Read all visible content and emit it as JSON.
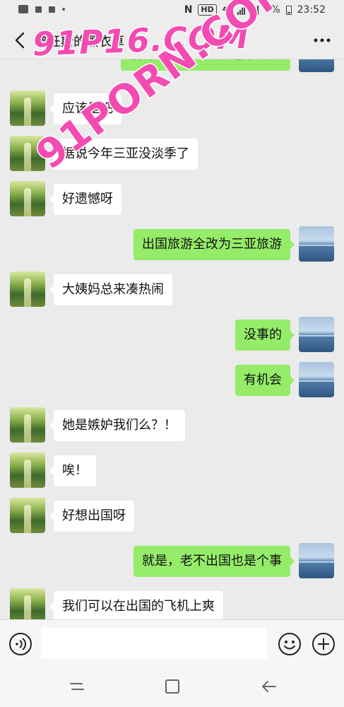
{
  "status_bar": {
    "network": "4G",
    "hd": "HD",
    "battery_percent": "5%",
    "time": "23:52"
  },
  "header": {
    "title": "普旺斯的薰衣草"
  },
  "messages": [
    {
      "side": "right",
      "text": "估计三亚这几天人也不会少"
    },
    {
      "side": "left",
      "text": "应该是吧"
    },
    {
      "side": "left",
      "text": "据说今年三亚没淡季了"
    },
    {
      "side": "left",
      "text": "好遗憾呀"
    },
    {
      "side": "right",
      "text": "出国旅游全改为三亚旅游"
    },
    {
      "side": "left",
      "text": "大姨妈总来凑热闹"
    },
    {
      "side": "right",
      "text": "没事的"
    },
    {
      "side": "right",
      "text": "有机会"
    },
    {
      "side": "left",
      "text": "她是嫉妒我们么？！"
    },
    {
      "side": "left",
      "text": "唉！"
    },
    {
      "side": "left",
      "text": "好想出国呀"
    },
    {
      "side": "right",
      "text": "就是，老不出国也是个事"
    },
    {
      "side": "left",
      "text": "我们可以在出国的飞机上爽"
    }
  ],
  "input": {
    "value": ""
  },
  "watermarks": [
    "91P16.COM",
    "91PORN.COM"
  ],
  "colors": {
    "sent_bubble": "#95ec69",
    "received_bubble": "#ffffff",
    "background": "#ebebeb",
    "watermark": "#f34bb1"
  },
  "icons": [
    "back-icon",
    "more-icon",
    "voice-icon",
    "emoji-icon",
    "plus-icon",
    "recents-icon",
    "home-icon",
    "back-nav-icon"
  ]
}
